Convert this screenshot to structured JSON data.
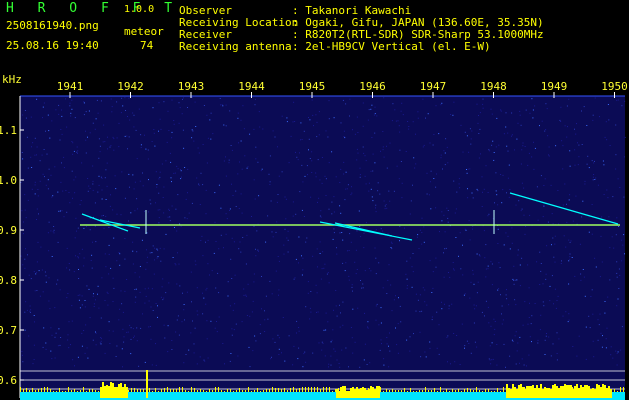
{
  "app": {
    "logo": "H R O F F T",
    "version": "1.0.0",
    "filename": "2508161940.png",
    "datetime": "25.08.16 19:40",
    "meteor_label": "meteor",
    "meteor_count": "74"
  },
  "info": {
    "labels": [
      "Observer",
      "Receiving Location",
      "Receiver",
      "Receiving antenna"
    ],
    "values": [
      ": Takanori Kawachi",
      ": Ogaki, Gifu, JAPAN (136.60E, 35.35N)",
      ": R820T2(RTL-SDR) SDR-Sharp 53.1000MHz",
      ": 2el-HB9CV Vertical (el. E-W)"
    ]
  },
  "chart_data": {
    "type": "heatmap",
    "ylabel": "kHz",
    "x_ticks": [
      "1941",
      "1942",
      "1943",
      "1944",
      "1945",
      "1946",
      "1947",
      "1948",
      "1949",
      "1950"
    ],
    "y_ticks": [
      "1.1",
      "1.0",
      "0.9",
      "0.8",
      "0.7",
      "0.6"
    ],
    "y_range": [
      0.6,
      1.15
    ],
    "x_range": [
      1941,
      1950
    ],
    "carrier_khz": 0.91,
    "background_color": "#0b0b55",
    "signal_color": "#00ffff",
    "carrier_color": "#a0ff60",
    "noise_floor_color": "#ffff00"
  }
}
